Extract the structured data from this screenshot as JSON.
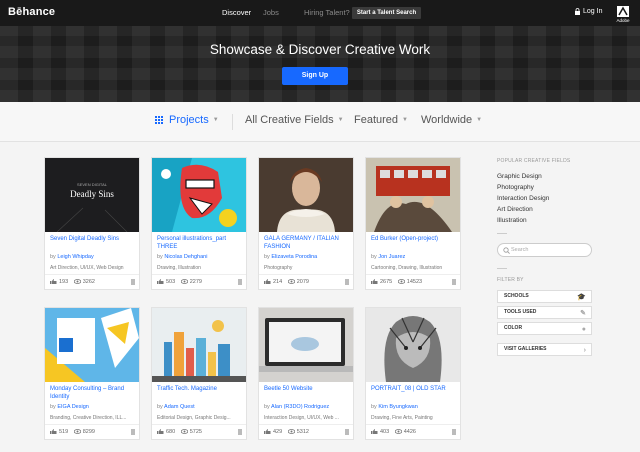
{
  "header": {
    "logo": "Bēhance",
    "nav": [
      "Discover",
      "Jobs",
      "Hiring Talent?"
    ],
    "talent_button": "Start a Talent Search",
    "login": "Log In",
    "adobe": "Adobe"
  },
  "hero": {
    "title": "Showcase & Discover Creative Work",
    "signup": "Sign Up"
  },
  "filters": {
    "projects": "Projects",
    "fields": "All Creative Fields",
    "featured": "Featured",
    "region": "Worldwide"
  },
  "cards": [
    {
      "title": "Seven Digital Deadly Sins",
      "by": "by",
      "author": "Leigh Whipday",
      "fields": "Art Direction, UI/UX, Web Design",
      "likes": "193",
      "views": "3262",
      "thumb_text_top": "SEVEN DIGITAL",
      "thumb_text_main": "Deadly Sins"
    },
    {
      "title": "Personal illustrations_part THREE",
      "by": "by",
      "author": "Nicolas Dehghani",
      "fields": "Drawing, Illustration",
      "likes": "503",
      "views": "2279"
    },
    {
      "title": "GALA GERMANY / ITALIAN FASHION",
      "by": "by",
      "author": "Elizaveta Porodina",
      "fields": "Photography",
      "likes": "214",
      "views": "2079"
    },
    {
      "title": "Ed Burker (Open-project)",
      "by": "by",
      "author": "Jon Juarez",
      "fields": "Cartooning, Drawing, Illustration",
      "likes": "2675",
      "views": "14523"
    },
    {
      "title": "Monday Consulting – Brand Identity",
      "by": "by",
      "author": "EIGA Design",
      "fields": "Branding, Creative Direction, ILL...",
      "likes": "519",
      "views": "8299"
    },
    {
      "title": "Traffic Tech. Magazine",
      "by": "by",
      "author": "Adam Quest",
      "fields": "Editorial Design, Graphic Desig...",
      "likes": "680",
      "views": "5725"
    },
    {
      "title": "Beetle 50 Website",
      "by": "by",
      "author": "Alan (R3DO) Rodriguez",
      "fields": "Interaction Design, UI/UX, Web ...",
      "likes": "429",
      "views": "5312"
    },
    {
      "title": "PORTRAIT_08 | OLD STAR",
      "by": "by",
      "author": "Kim Byungkwan",
      "fields": "Drawing, Fine Arts, Painting",
      "likes": "403",
      "views": "4426"
    }
  ],
  "sidebar": {
    "popular_heading": "POPULAR CREATIVE FIELDS",
    "popular": [
      "Graphic Design",
      "Photography",
      "Interaction Design",
      "Art Direction",
      "Illustration"
    ],
    "search_placeholder": "Search",
    "filter_heading": "FILTER BY",
    "filters": [
      "SCHOOLS",
      "TOOLS USED",
      "COLOR"
    ],
    "galleries": "VISIT GALLERIES"
  },
  "colors": {
    "accent": "#1769ff",
    "topbar": "#191919"
  }
}
